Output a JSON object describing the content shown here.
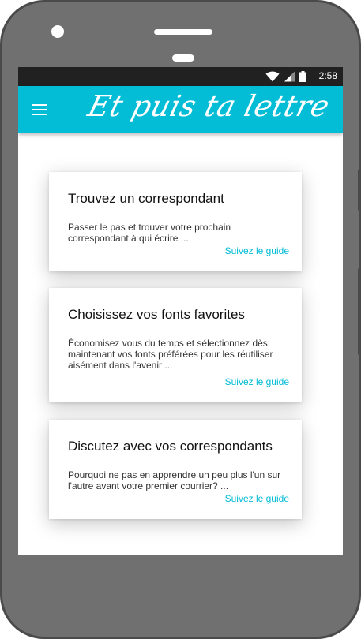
{
  "status_bar": {
    "time": "2:58",
    "icons": [
      "wifi-icon",
      "signal-icon",
      "battery-icon"
    ]
  },
  "app_bar": {
    "title": "Et puis ta lettre",
    "menu_icon": "hamburger-menu-icon",
    "color": "#03bcd6"
  },
  "cards": [
    {
      "title": "Trouvez un correspondant",
      "description": "Passer le pas et trouver votre prochain correspondant à qui écrire ...",
      "link": "Suivez le guide"
    },
    {
      "title": "Choisissez vos fonts favorites",
      "description": "Économisez vous du temps et sélectionnez dès maintenant vos fonts préférées pour les réutiliser aisément dans l'avenir ...",
      "link": "Suivez le guide"
    },
    {
      "title": "Discutez avec vos correspondants",
      "description": "Pourquoi ne pas en apprendre un peu plus l'un sur l'autre avant votre premier courrier? ...",
      "link": "Suivez le guide"
    }
  ]
}
